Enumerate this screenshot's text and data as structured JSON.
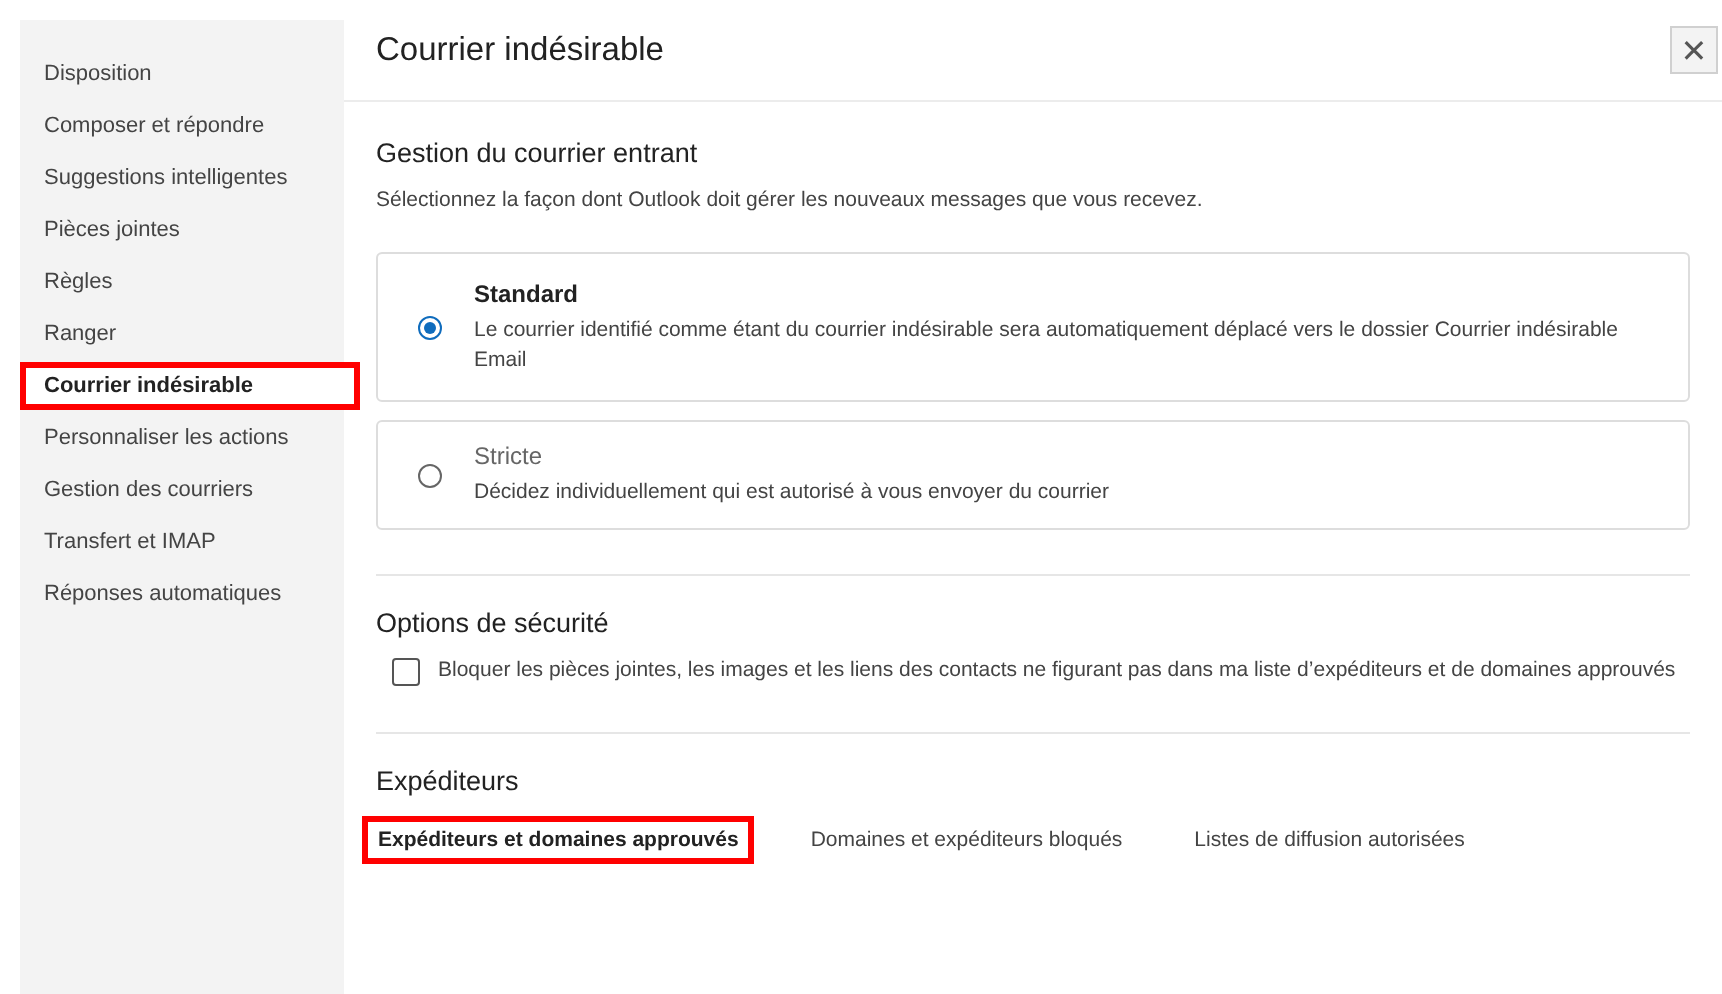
{
  "sidebar": {
    "items": [
      {
        "label": "Disposition",
        "selected": false,
        "highlighted": false
      },
      {
        "label": "Composer et répondre",
        "selected": false,
        "highlighted": false
      },
      {
        "label": "Suggestions intelligentes",
        "selected": false,
        "highlighted": false
      },
      {
        "label": "Pièces jointes",
        "selected": false,
        "highlighted": false
      },
      {
        "label": "Règles",
        "selected": false,
        "highlighted": false
      },
      {
        "label": "Ranger",
        "selected": false,
        "highlighted": false
      },
      {
        "label": "Courrier indésirable",
        "selected": true,
        "highlighted": true
      },
      {
        "label": "Personnaliser les actions",
        "selected": false,
        "highlighted": false
      },
      {
        "label": "Gestion des courriers",
        "selected": false,
        "highlighted": false
      },
      {
        "label": "Transfert et IMAP",
        "selected": false,
        "highlighted": false
      },
      {
        "label": "Réponses automatiques",
        "selected": false,
        "highlighted": false
      }
    ]
  },
  "panel": {
    "title": "Courrier indésirable",
    "close": "✕"
  },
  "incoming": {
    "heading": "Gestion du courrier entrant",
    "description": "Sélectionnez la façon dont Outlook doit gérer les nouveaux messages que vous recevez.",
    "options": [
      {
        "label": "Standard",
        "description": "Le courrier identifié comme étant du courrier indésirable sera automatiquement déplacé vers le dossier Courrier indésirable Email",
        "selected": true
      },
      {
        "label": "Stricte",
        "description": "Décidez individuellement qui est autorisé à vous envoyer du courrier",
        "selected": false
      }
    ]
  },
  "security": {
    "heading": "Options de sécurité",
    "checkbox": {
      "label": "Bloquer les pièces jointes, les images et les liens des contacts ne figurant pas dans ma liste d’expéditeurs et de domaines approuvés",
      "checked": false
    }
  },
  "senders": {
    "heading": "Expéditeurs",
    "tabs": [
      {
        "label": "Expéditeurs et domaines approuvés",
        "selected": true,
        "highlighted": true
      },
      {
        "label": "Domaines et expéditeurs bloqués",
        "selected": false,
        "highlighted": false
      },
      {
        "label": "Listes de diffusion autorisées",
        "selected": false,
        "highlighted": false
      }
    ]
  }
}
